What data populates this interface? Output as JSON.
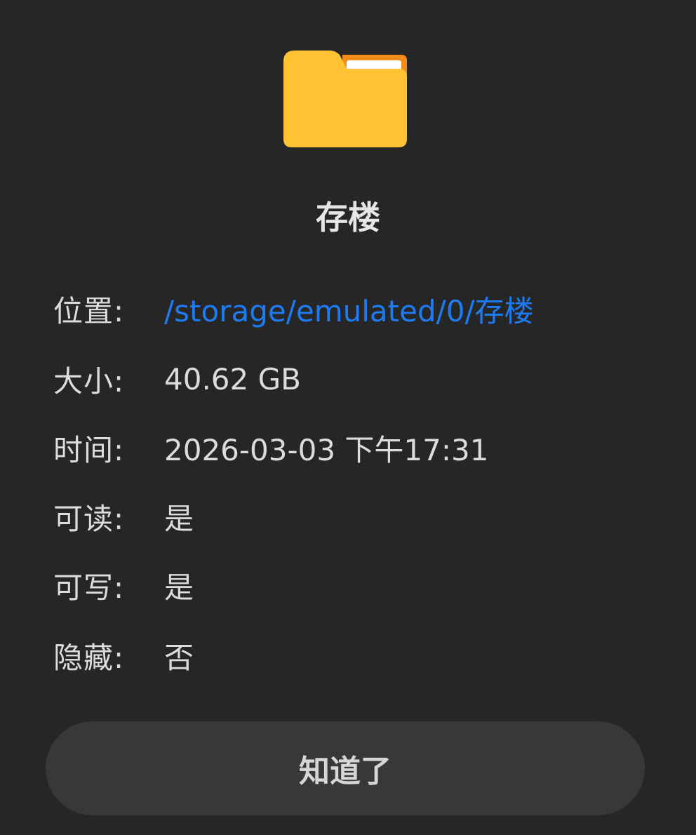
{
  "dialog": {
    "icon": "folder-icon",
    "title": "存楼",
    "rows": [
      {
        "label": "位置:",
        "value": "/storage/emulated/0/存楼"
      },
      {
        "label": "大小:",
        "value": "40.62 GB"
      },
      {
        "label": "时间:",
        "value": "2026-03-03 下午17:31"
      },
      {
        "label": "可读:",
        "value": "是"
      },
      {
        "label": "可写:",
        "value": "是"
      },
      {
        "label": "隐藏:",
        "value": "否"
      }
    ],
    "ok_label": "知道了"
  },
  "colors": {
    "background": "#262626",
    "link": "#1e7bf2",
    "folder": "#ffc233",
    "folder_tab": "#f08c1a"
  }
}
